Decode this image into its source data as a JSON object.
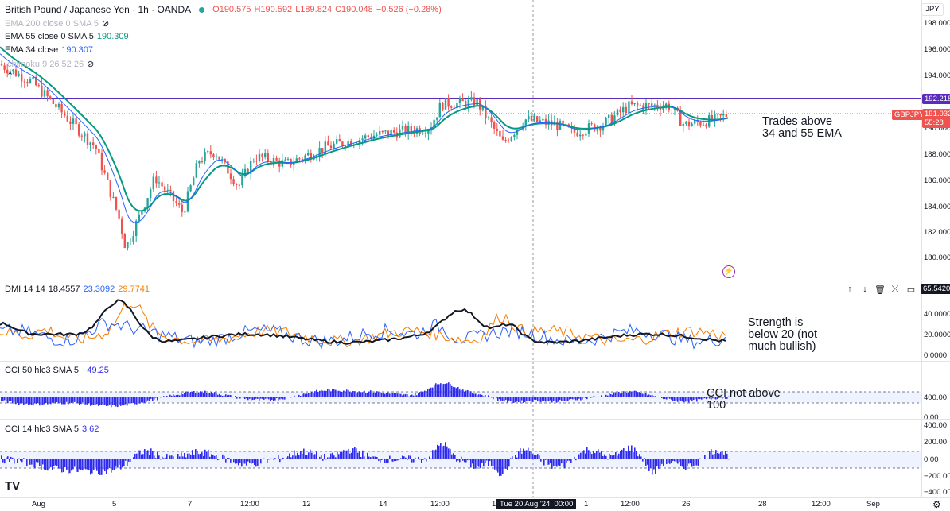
{
  "symbol_title": "British Pound / Japanese Yen · 1h · OANDA",
  "ohlc": {
    "open": "O190.575",
    "high": "H190.592",
    "low": "L189.824",
    "close": "C190.048",
    "change": "−0.526 (−0.28%)"
  },
  "indicators": {
    "ema200": "EMA 200 close 0 SMA 5",
    "ema55_label": "EMA 55 close 0 SMA 5",
    "ema55_value": "190.309",
    "ema34_label": "EMA 34 close",
    "ema34_value": "190.307",
    "ichimoku": "Ichimoku 9 26 52 26"
  },
  "currency": "JPY",
  "price_axis": [
    "198.000",
    "196.000",
    "194.000",
    "192.000",
    "190.000",
    "188.000",
    "186.000",
    "184.000",
    "182.000",
    "180.000"
  ],
  "price_tags": {
    "resistance": "192.218",
    "symbol": "GBPJPY",
    "last": "191.032",
    "countdown": "55:28"
  },
  "dmi": {
    "label": "DMI 14 14",
    "v1": "18.4557",
    "v2": "23.3092",
    "v3": "29.7741",
    "axis": [
      "40.0000",
      "20.0000",
      "0.0000"
    ],
    "tag": "65.5420"
  },
  "cci50": {
    "label": "CCI 50 hlc3 SMA 5",
    "value": "−49.25",
    "axis": [
      "400.00",
      "0.00"
    ]
  },
  "cci14": {
    "label": "CCI 14 hlc3 SMA 5",
    "value": "3.62",
    "axis": [
      "400.00",
      "200.00",
      "0.00",
      "−200.00",
      "−400.00"
    ]
  },
  "x_axis": [
    "Aug",
    "5",
    "7",
    "12:00",
    "12",
    "14",
    "12:00",
    "1",
    "1",
    "12:00",
    "26",
    "28",
    "12:00",
    "Sep"
  ],
  "crosshair_date": "Tue 20 Aug '24  00:00",
  "annotations": {
    "trend": [
      "Trades above",
      "34 and 55 EMA"
    ],
    "strength": [
      "Strength is",
      "below 20 (not",
      "much bullish)"
    ],
    "cci": [
      "CCI not above",
      "100"
    ]
  },
  "colors": {
    "up": "#26a69a",
    "down": "#ef5350",
    "ema55": "#089981",
    "ema34": "#2962ff",
    "resistance": "#5b2bbd",
    "cci": "#2f2cf0",
    "dmi_adx": "#131722",
    "dmi_plus": "#2962ff",
    "dmi_minus": "#f57c00"
  }
}
